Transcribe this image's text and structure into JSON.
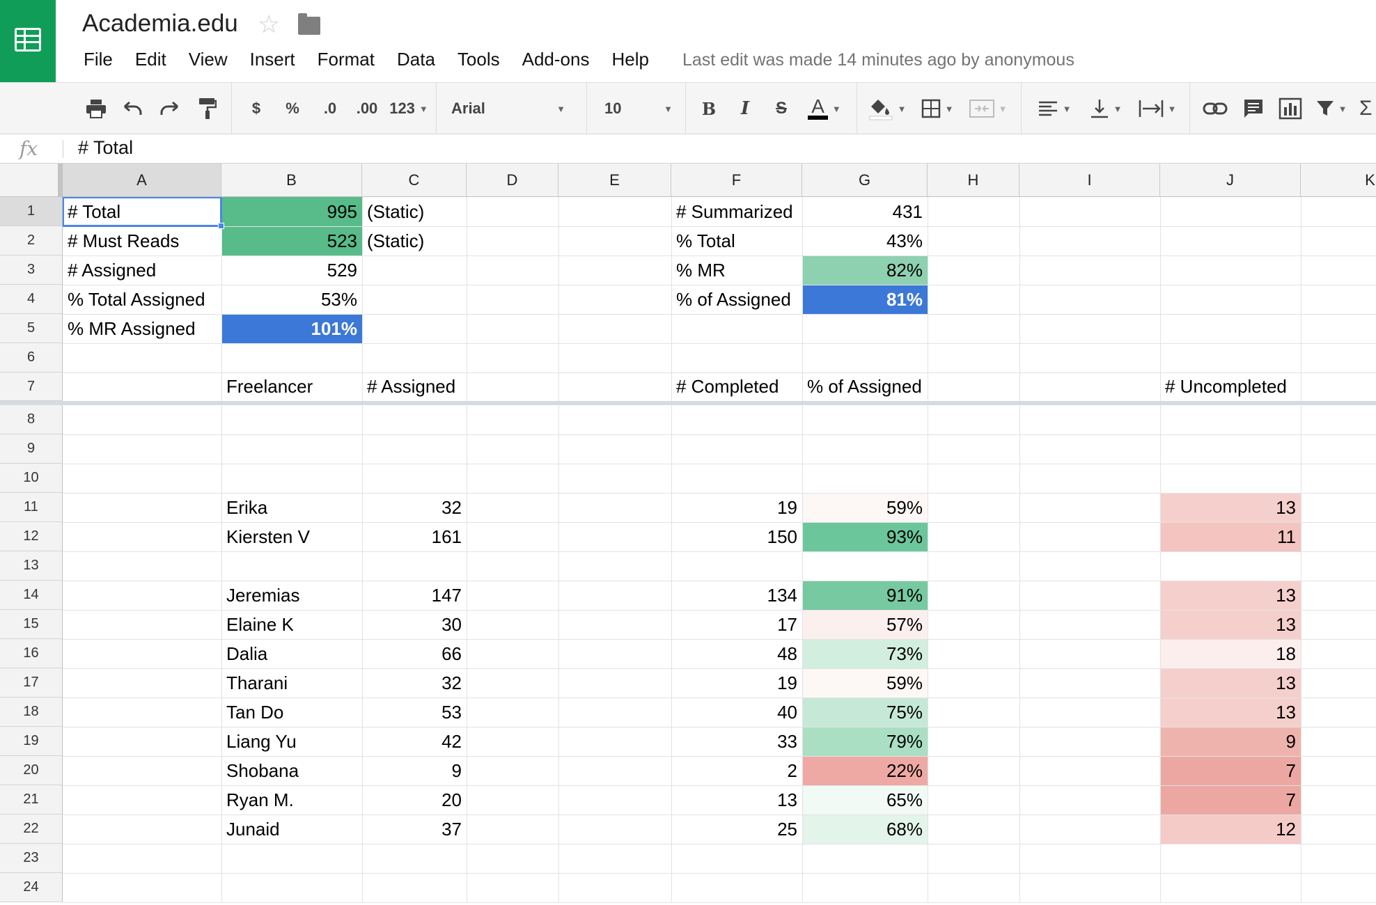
{
  "app": {
    "doc_title": "Academia.edu",
    "last_edit": "Last edit was made 14 minutes ago by anonymous",
    "brand_color": "#0f9d58"
  },
  "menu": [
    "File",
    "Edit",
    "View",
    "Insert",
    "Format",
    "Data",
    "Tools",
    "Add-ons",
    "Help"
  ],
  "toolbar": {
    "currency": "$",
    "percent": "%",
    "decrease_decimal": ".0",
    "increase_decimal": ".00",
    "more_formats": "123",
    "font": "Arial",
    "font_size": "10",
    "bold": "B",
    "italic": "I",
    "strike": "S",
    "text_color": "A"
  },
  "formula_bar": {
    "fx_label": "fx",
    "content": "# Total"
  },
  "columns": [
    "A",
    "B",
    "C",
    "D",
    "E",
    "F",
    "G",
    "H",
    "I",
    "J",
    "K"
  ],
  "rows": [
    "1",
    "2",
    "3",
    "4",
    "5",
    "6",
    "7",
    "8",
    "9",
    "10",
    "11",
    "12",
    "13",
    "14",
    "15",
    "16",
    "17",
    "18",
    "19",
    "20",
    "21",
    "22",
    "23",
    "24"
  ],
  "selected_cell": "A1",
  "colors": {
    "green_strong": "#57bb8a",
    "blue_highlight": "#3c78d8"
  },
  "cells": [
    {
      "ref": "A1",
      "v": "# Total"
    },
    {
      "ref": "B1",
      "v": "995",
      "num": true,
      "bg": "#57bb8a"
    },
    {
      "ref": "C1",
      "v": "(Static)"
    },
    {
      "ref": "F1",
      "v": "# Summarized"
    },
    {
      "ref": "G1",
      "v": "431",
      "num": true
    },
    {
      "ref": "A2",
      "v": "# Must Reads"
    },
    {
      "ref": "B2",
      "v": "523",
      "num": true,
      "bg": "#57bb8a"
    },
    {
      "ref": "C2",
      "v": "(Static)"
    },
    {
      "ref": "F2",
      "v": "% Total"
    },
    {
      "ref": "G2",
      "v": "43%",
      "num": true
    },
    {
      "ref": "A3",
      "v": "# Assigned"
    },
    {
      "ref": "B3",
      "v": "529",
      "num": true
    },
    {
      "ref": "F3",
      "v": "% MR"
    },
    {
      "ref": "G3",
      "v": "82%",
      "num": true,
      "bg": "#8ed1b0"
    },
    {
      "ref": "A4",
      "v": "% Total Assigned"
    },
    {
      "ref": "B4",
      "v": "53%",
      "num": true
    },
    {
      "ref": "F4",
      "v": "% of Assigned"
    },
    {
      "ref": "G4",
      "v": "81%",
      "num": true,
      "bg": "#3c78d8",
      "bold": true,
      "white": true
    },
    {
      "ref": "A5",
      "v": "% MR Assigned"
    },
    {
      "ref": "B5",
      "v": "101%",
      "num": true,
      "bg": "#3c78d8",
      "bold": true,
      "white": true
    },
    {
      "ref": "B7",
      "v": "Freelancer"
    },
    {
      "ref": "C7",
      "v": "# Assigned"
    },
    {
      "ref": "F7",
      "v": "# Completed"
    },
    {
      "ref": "G7",
      "v": "% of Assigned"
    },
    {
      "ref": "J7",
      "v": "# Uncompleted"
    },
    {
      "ref": "B11",
      "v": "Erika"
    },
    {
      "ref": "C11",
      "v": "32",
      "num": true
    },
    {
      "ref": "F11",
      "v": "19",
      "num": true
    },
    {
      "ref": "G11",
      "v": "59%",
      "num": true,
      "bg": "#fdf7f6"
    },
    {
      "ref": "J11",
      "v": "13",
      "num": true,
      "bg": "#f5cfcc"
    },
    {
      "ref": "B12",
      "v": "Kiersten V"
    },
    {
      "ref": "C12",
      "v": "161",
      "num": true
    },
    {
      "ref": "F12",
      "v": "150",
      "num": true
    },
    {
      "ref": "G12",
      "v": "93%",
      "num": true,
      "bg": "#6cc69b"
    },
    {
      "ref": "J12",
      "v": "11",
      "num": true,
      "bg": "#f3c4c0"
    },
    {
      "ref": "B14",
      "v": "Jeremias"
    },
    {
      "ref": "C14",
      "v": "147",
      "num": true
    },
    {
      "ref": "F14",
      "v": "134",
      "num": true
    },
    {
      "ref": "G14",
      "v": "91%",
      "num": true,
      "bg": "#76c9a0"
    },
    {
      "ref": "J14",
      "v": "13",
      "num": true,
      "bg": "#f5cfcc"
    },
    {
      "ref": "B15",
      "v": "Elaine K"
    },
    {
      "ref": "C15",
      "v": "30",
      "num": true
    },
    {
      "ref": "F15",
      "v": "17",
      "num": true
    },
    {
      "ref": "G15",
      "v": "57%",
      "num": true,
      "bg": "#fcf0ef"
    },
    {
      "ref": "J15",
      "v": "13",
      "num": true,
      "bg": "#f5cfcc"
    },
    {
      "ref": "B16",
      "v": "Dalia"
    },
    {
      "ref": "C16",
      "v": "66",
      "num": true
    },
    {
      "ref": "F16",
      "v": "48",
      "num": true
    },
    {
      "ref": "G16",
      "v": "73%",
      "num": true,
      "bg": "#d2eedf"
    },
    {
      "ref": "J16",
      "v": "18",
      "num": true,
      "bg": "#fbeeed"
    },
    {
      "ref": "B17",
      "v": "Tharani"
    },
    {
      "ref": "C17",
      "v": "32",
      "num": true
    },
    {
      "ref": "F17",
      "v": "19",
      "num": true
    },
    {
      "ref": "G17",
      "v": "59%",
      "num": true,
      "bg": "#fdf7f6"
    },
    {
      "ref": "J17",
      "v": "13",
      "num": true,
      "bg": "#f5cfcc"
    },
    {
      "ref": "B18",
      "v": "Tan Do"
    },
    {
      "ref": "C18",
      "v": "53",
      "num": true
    },
    {
      "ref": "F18",
      "v": "40",
      "num": true
    },
    {
      "ref": "G18",
      "v": "75%",
      "num": true,
      "bg": "#c5e9d6"
    },
    {
      "ref": "J18",
      "v": "13",
      "num": true,
      "bg": "#f5cfcc"
    },
    {
      "ref": "B19",
      "v": "Liang Yu"
    },
    {
      "ref": "C19",
      "v": "42",
      "num": true
    },
    {
      "ref": "F19",
      "v": "33",
      "num": true
    },
    {
      "ref": "G19",
      "v": "79%",
      "num": true,
      "bg": "#abdfc4"
    },
    {
      "ref": "J19",
      "v": "9",
      "num": true,
      "bg": "#efb3ae"
    },
    {
      "ref": "B20",
      "v": "Shobana"
    },
    {
      "ref": "C20",
      "v": "9",
      "num": true
    },
    {
      "ref": "F20",
      "v": "2",
      "num": true
    },
    {
      "ref": "G20",
      "v": "22%",
      "num": true,
      "bg": "#eea9a4"
    },
    {
      "ref": "J20",
      "v": "7",
      "num": true,
      "bg": "#eca7a2"
    },
    {
      "ref": "B21",
      "v": "Ryan M."
    },
    {
      "ref": "C21",
      "v": "20",
      "num": true
    },
    {
      "ref": "F21",
      "v": "13",
      "num": true
    },
    {
      "ref": "G21",
      "v": "65%",
      "num": true,
      "bg": "#f1faf5"
    },
    {
      "ref": "J21",
      "v": "7",
      "num": true,
      "bg": "#eca7a2"
    },
    {
      "ref": "B22",
      "v": "Junaid"
    },
    {
      "ref": "C22",
      "v": "37",
      "num": true
    },
    {
      "ref": "F22",
      "v": "25",
      "num": true
    },
    {
      "ref": "G22",
      "v": "68%",
      "num": true,
      "bg": "#e3f4eb"
    },
    {
      "ref": "J22",
      "v": "12",
      "num": true,
      "bg": "#f5cbc8"
    }
  ]
}
